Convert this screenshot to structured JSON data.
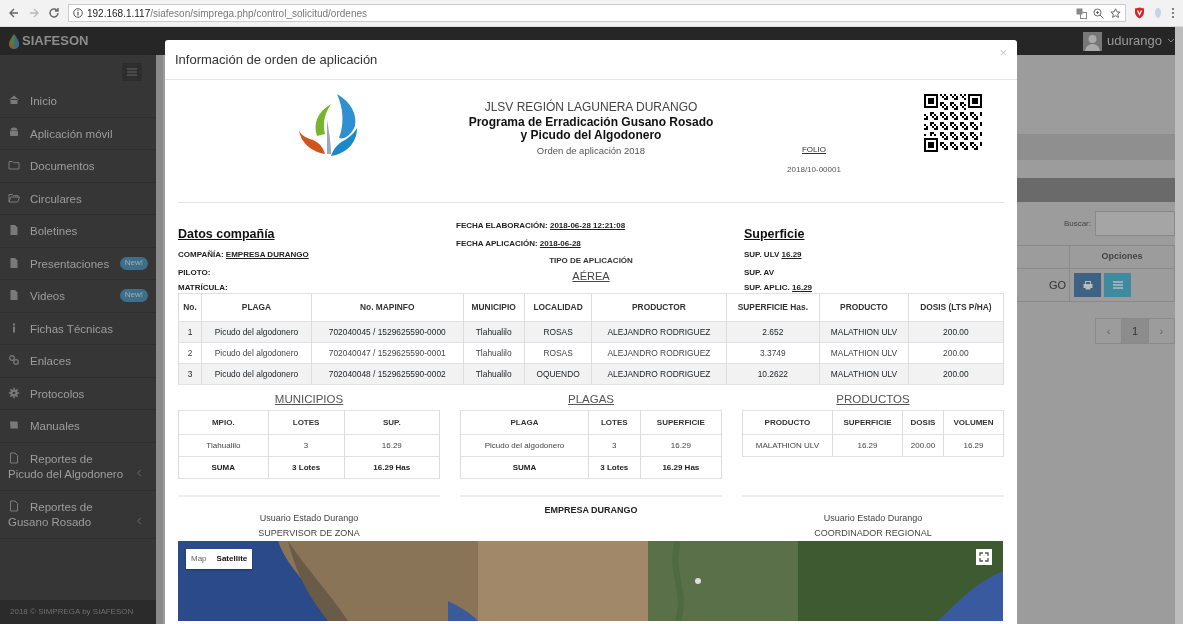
{
  "browser": {
    "url_host": "192.168.1.117",
    "url_path": "/siafeson/simprega.php/control_solicitud/ordenes"
  },
  "app": {
    "brand": "SIAFESON",
    "user": "udurango"
  },
  "sidebar": {
    "items": [
      {
        "label": "Inicio",
        "expandable": false
      },
      {
        "label": "Aplicación móvil",
        "expandable": false
      },
      {
        "label": "Documentos",
        "expandable": false
      },
      {
        "label": "Circulares",
        "expandable": false
      },
      {
        "label": "Boletines",
        "expandable": false
      },
      {
        "label": "Presentaciones",
        "badge": "New!",
        "expandable": false
      },
      {
        "label": "Videos",
        "badge": "New!",
        "expandable": false
      },
      {
        "label": "Fichas Técnicas",
        "expandable": false
      },
      {
        "label": "Enlaces",
        "expandable": false
      },
      {
        "label": "Protocolos",
        "expandable": false
      },
      {
        "label": "Manuales",
        "expandable": false
      },
      {
        "label": "Reportes de Picudo del Algodonero",
        "expandable": true
      },
      {
        "label": "Reportes de Gusano Rosado",
        "expandable": true
      }
    ],
    "footer": "2018 © SIMPREGA by SIAFESON"
  },
  "background": {
    "search_label": "Buscar:",
    "column": "Opciones",
    "cell": "GO",
    "pagination": [
      {
        "label": "‹",
        "selected": false
      },
      {
        "label": "1",
        "selected": true
      },
      {
        "label": "›",
        "selected": false
      }
    ]
  },
  "modal": {
    "title": "Información de orden de aplicación",
    "close": "×",
    "org": "JLSV REGIÓN LAGUNERA DURANGO",
    "program_lines": [
      "Programa de Erradicación Gusano Rosado",
      "y Picudo del Algodonero"
    ],
    "subtitle": "Orden de aplicación 2018",
    "folio_label": "FOLIO",
    "folio": "2018/10-00001",
    "company": {
      "heading": "Datos compañía",
      "fields": [
        {
          "label": "COMPAÑÍA:",
          "value": "EMPRESA DURANGO"
        },
        {
          "label": "PILOTO:"
        },
        {
          "label": "MATRÍCULA:"
        }
      ]
    },
    "dates": {
      "fields": [
        {
          "label": "FECHA ELABORACIÓN:",
          "value": "2018-06-28 12:21:08"
        },
        {
          "label": "FECHA APLICACIÓN:",
          "value": "2018-06-28"
        }
      ],
      "tipo_label": "TIPO DE APLICACIÓN",
      "tipo": "AÉREA"
    },
    "surface": {
      "heading": "Superficie",
      "fields": [
        {
          "label": "SUP. ULV",
          "value": "16.29"
        },
        {
          "label": "SUP. AV"
        },
        {
          "label": "SUP. APLIC.",
          "value": "16.29"
        }
      ]
    },
    "table": {
      "columns": [
        "No.",
        "PLAGA",
        "No. MAPINFO",
        "MUNICIPIO",
        "LOCALIDAD",
        "PRODUCTOR",
        "SUPERFICIE Has.",
        "PRODUCTO",
        "DOSIS (LTS P/HA)"
      ],
      "rows": [
        [
          "1",
          "Picudo del algodonero",
          "702040045 / 1529625590-0000",
          "Tlahualilo",
          "ROSAS",
          "ALEJANDRO RODRIGUEZ",
          "2.652",
          "MALATHION ULV",
          "200.00"
        ],
        [
          "2",
          "Picudo del algodonero",
          "702040047 / 1529625590-0001",
          "Tlahualilo",
          "ROSAS",
          "ALEJANDRO RODRIGUEZ",
          "3.3749",
          "MALATHION ULV",
          "200.00"
        ],
        [
          "3",
          "Picudo del algodonero",
          "702040048 / 1529625590-0002",
          "Tlahualilo",
          "OQUENDO",
          "ALEJANDRO RODRIGUEZ",
          "10.2622",
          "MALATHION ULV",
          "200.00"
        ]
      ]
    },
    "summaries": [
      {
        "title": "MUNICIPIOS",
        "columns": [
          "MPIO.",
          "LOTES",
          "SUP."
        ],
        "rows": [
          [
            "Tlahualilo",
            "3",
            "16.29"
          ]
        ],
        "total": [
          "SUMA",
          "3 Lotes",
          "16.29 Has"
        ]
      },
      {
        "title": "PLAGAS",
        "columns": [
          "PLAGA",
          "LOTES",
          "SUPERFICIE"
        ],
        "rows": [
          [
            "Picudo del algodonero",
            "3",
            "16.29"
          ]
        ],
        "total": [
          "SUMA",
          "3 Lotes",
          "16.29 Has"
        ]
      },
      {
        "title": "PRODUCTOS",
        "columns": [
          "PRODUCTO",
          "SUPERFICIE",
          "DOSIS",
          "VOLUMEN"
        ],
        "rows": [
          [
            "MALATHION ULV",
            "16.29",
            "200.00",
            "16.29"
          ]
        ]
      }
    ],
    "signatures": [
      {
        "kind": "user",
        "lines": [
          "Usuario Estado Durango",
          "SUPERVISOR DE ZONA"
        ]
      },
      {
        "kind": "company",
        "lines": [
          "EMPRESA DURANGO"
        ]
      },
      {
        "kind": "user",
        "lines": [
          "Usuario Estado Durango",
          "COORDINADOR REGIONAL"
        ]
      }
    ],
    "map": {
      "kind": "picture",
      "types": [
        {
          "label": "Map",
          "selected": false
        },
        {
          "label": "Satellite",
          "selected": true
        }
      ]
    }
  }
}
